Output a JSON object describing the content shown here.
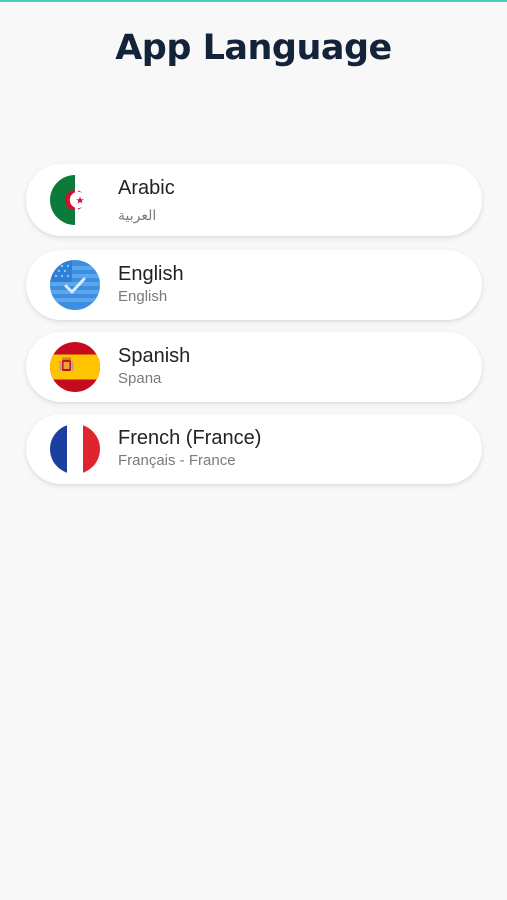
{
  "header": {
    "title": "App Language"
  },
  "colors": {
    "accent": "#4fc8b8",
    "title": "#13233a",
    "background": "#f8f8f9"
  },
  "languages": [
    {
      "name": "Arabic",
      "native": "العربية",
      "flag": "algeria-flag-icon"
    },
    {
      "name": "English",
      "native": "English",
      "flag": "english-flag-icon"
    },
    {
      "name": "Spanish",
      "native": "Spana",
      "flag": "spain-flag-icon"
    },
    {
      "name": "French (France)",
      "native": "Français - France",
      "flag": "france-flag-icon"
    }
  ]
}
